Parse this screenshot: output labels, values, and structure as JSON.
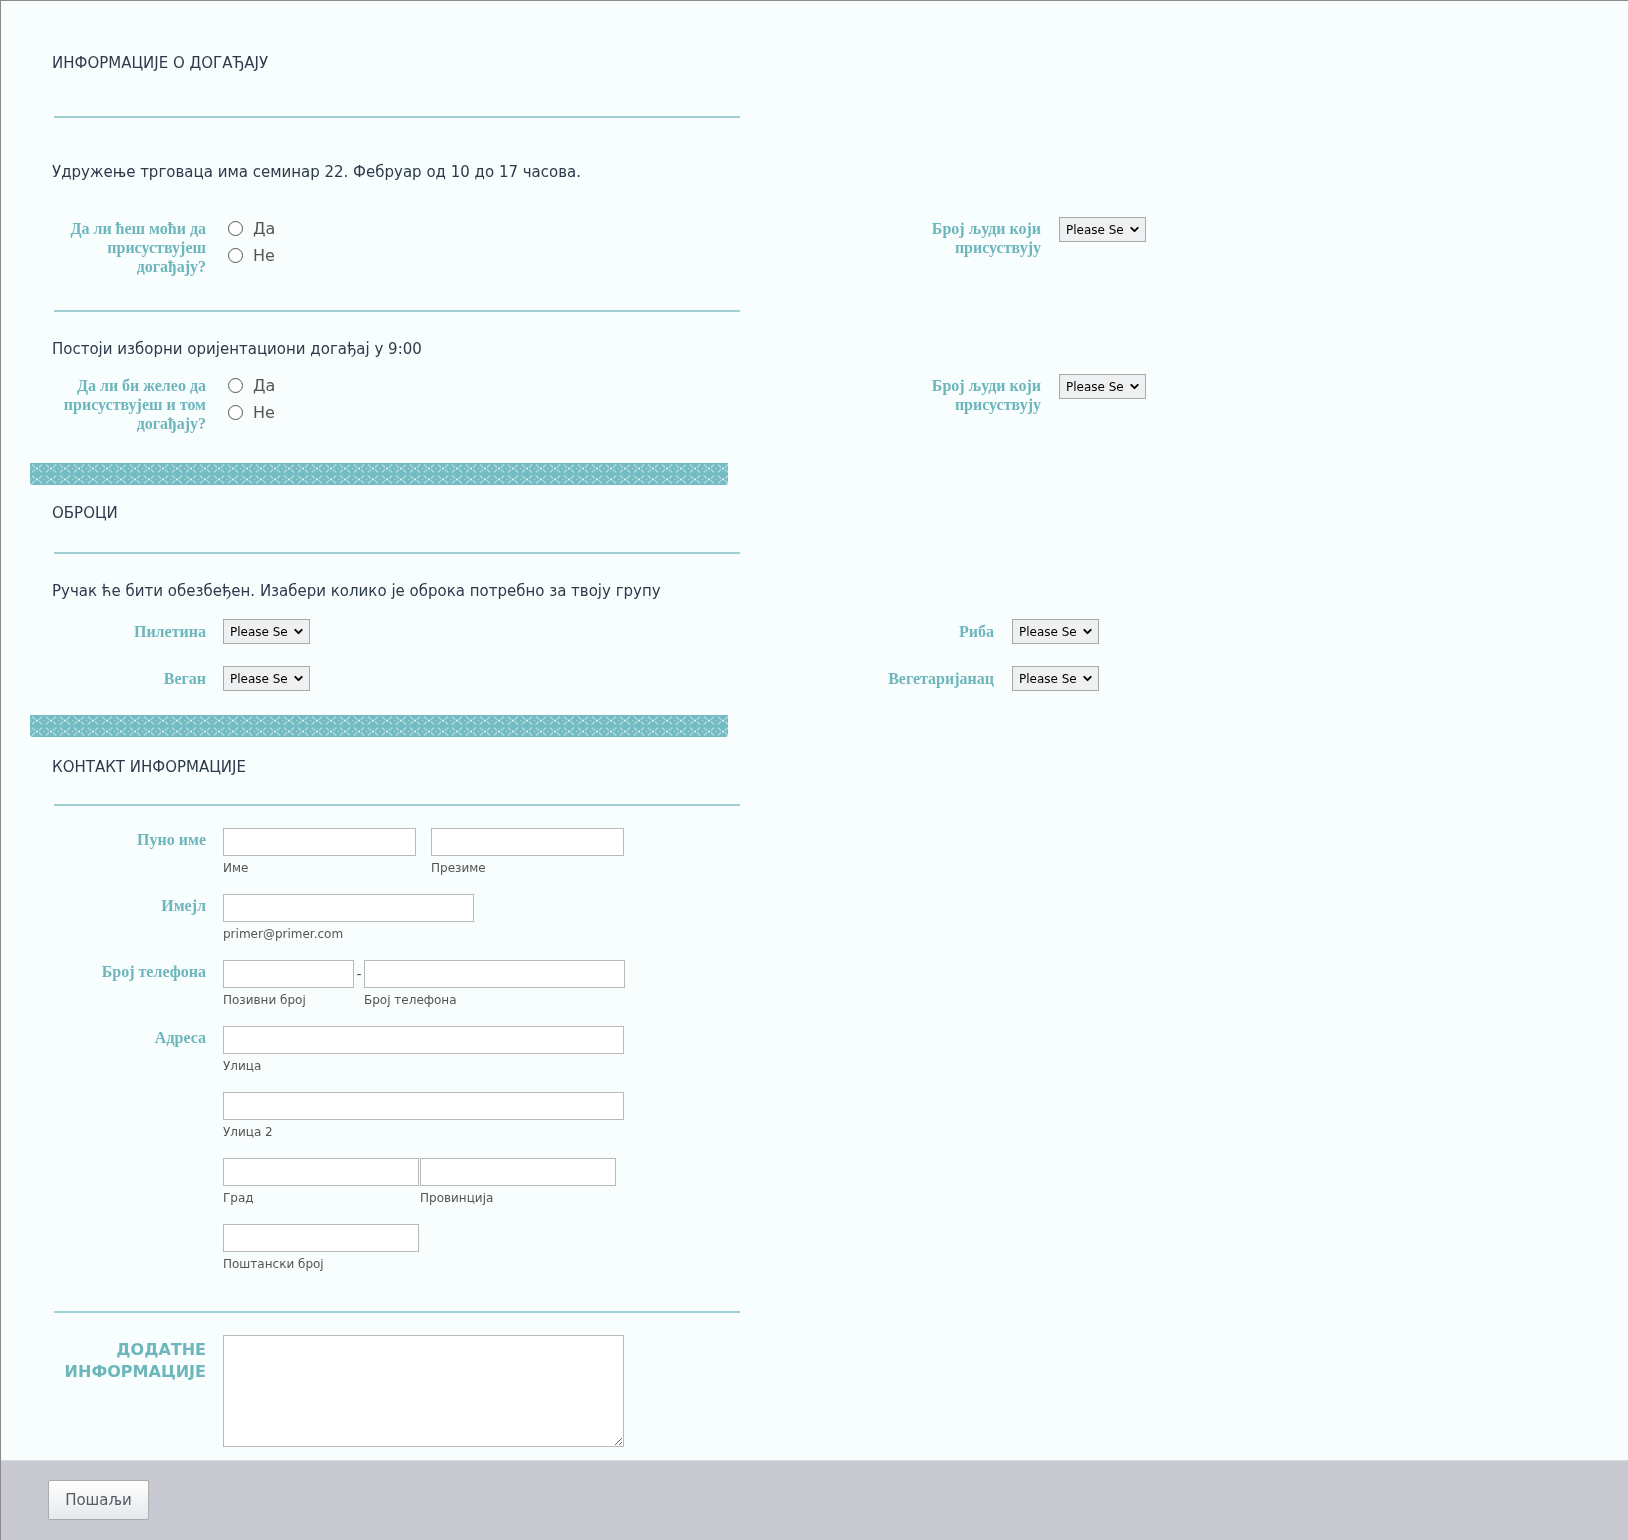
{
  "event_info": {
    "title": "ИНФОРМАЦИЈЕ О ДОГАЂАЈУ",
    "blocks": [
      {
        "description": "Удружење трговаца има семинар 22. Фебруар од 10 до 17 часова.",
        "question": {
          "label": "Да ли ћеш моћи да присуствујеш догађају?",
          "options": [
            {
              "label": "Да",
              "selected": false
            },
            {
              "label": "Не",
              "selected": false
            }
          ]
        },
        "count": {
          "label": "Број људи који присуствују",
          "value": "Please Se"
        }
      },
      {
        "description": "Постоји изборни оријентациони догађај у 9:00",
        "question": {
          "label": "Да ли би желео да присуствујеш и том догађају?",
          "options": [
            {
              "label": "Да",
              "selected": false
            },
            {
              "label": "Не",
              "selected": false
            }
          ]
        },
        "count": {
          "label": "Број људи који присуствују",
          "value": "Please Se"
        }
      }
    ]
  },
  "meals": {
    "title": "ОБРОЦИ",
    "description": "Ручак ће бити обезбеђен. Изабери колико је оброка потребно за твоју групу",
    "rows": [
      [
        {
          "label": "Пилетина",
          "value": "Please Se"
        },
        {
          "label": "Риба",
          "value": "Please Se"
        }
      ],
      [
        {
          "label": "Веган",
          "value": "Please Se"
        },
        {
          "label": "Вегетаријанац",
          "value": "Please Se"
        }
      ]
    ]
  },
  "contact": {
    "title": "КОНТАКТ ИНФОРМАЦИЈЕ",
    "fields": [
      {
        "label": "Пуно име",
        "kind": "name",
        "inputs": [
          {
            "sublabel": "Име"
          },
          {
            "sublabel": "Презиме"
          }
        ]
      },
      {
        "label": "Имејл",
        "kind": "email",
        "inputs": [
          {
            "sublabel": "primer@primer.com"
          }
        ]
      },
      {
        "label": "Број телефона",
        "kind": "phone",
        "separator": "-",
        "inputs": [
          {
            "sublabel": "Позивни број"
          },
          {
            "sublabel": "Број телефона"
          }
        ]
      },
      {
        "label": "Адреса",
        "kind": "address",
        "inputs": [
          {
            "sublabel": "Улица"
          },
          {
            "sublabel": "Улица 2"
          },
          {
            "sublabel": "Град"
          },
          {
            "sublabel": "Провинција"
          },
          {
            "sublabel": "Поштански број"
          }
        ]
      }
    ]
  },
  "additional_info": {
    "label": "ДОДАТНЕ ИНФОРМАЦИЈЕ"
  },
  "submit_button": "Пошаљи"
}
